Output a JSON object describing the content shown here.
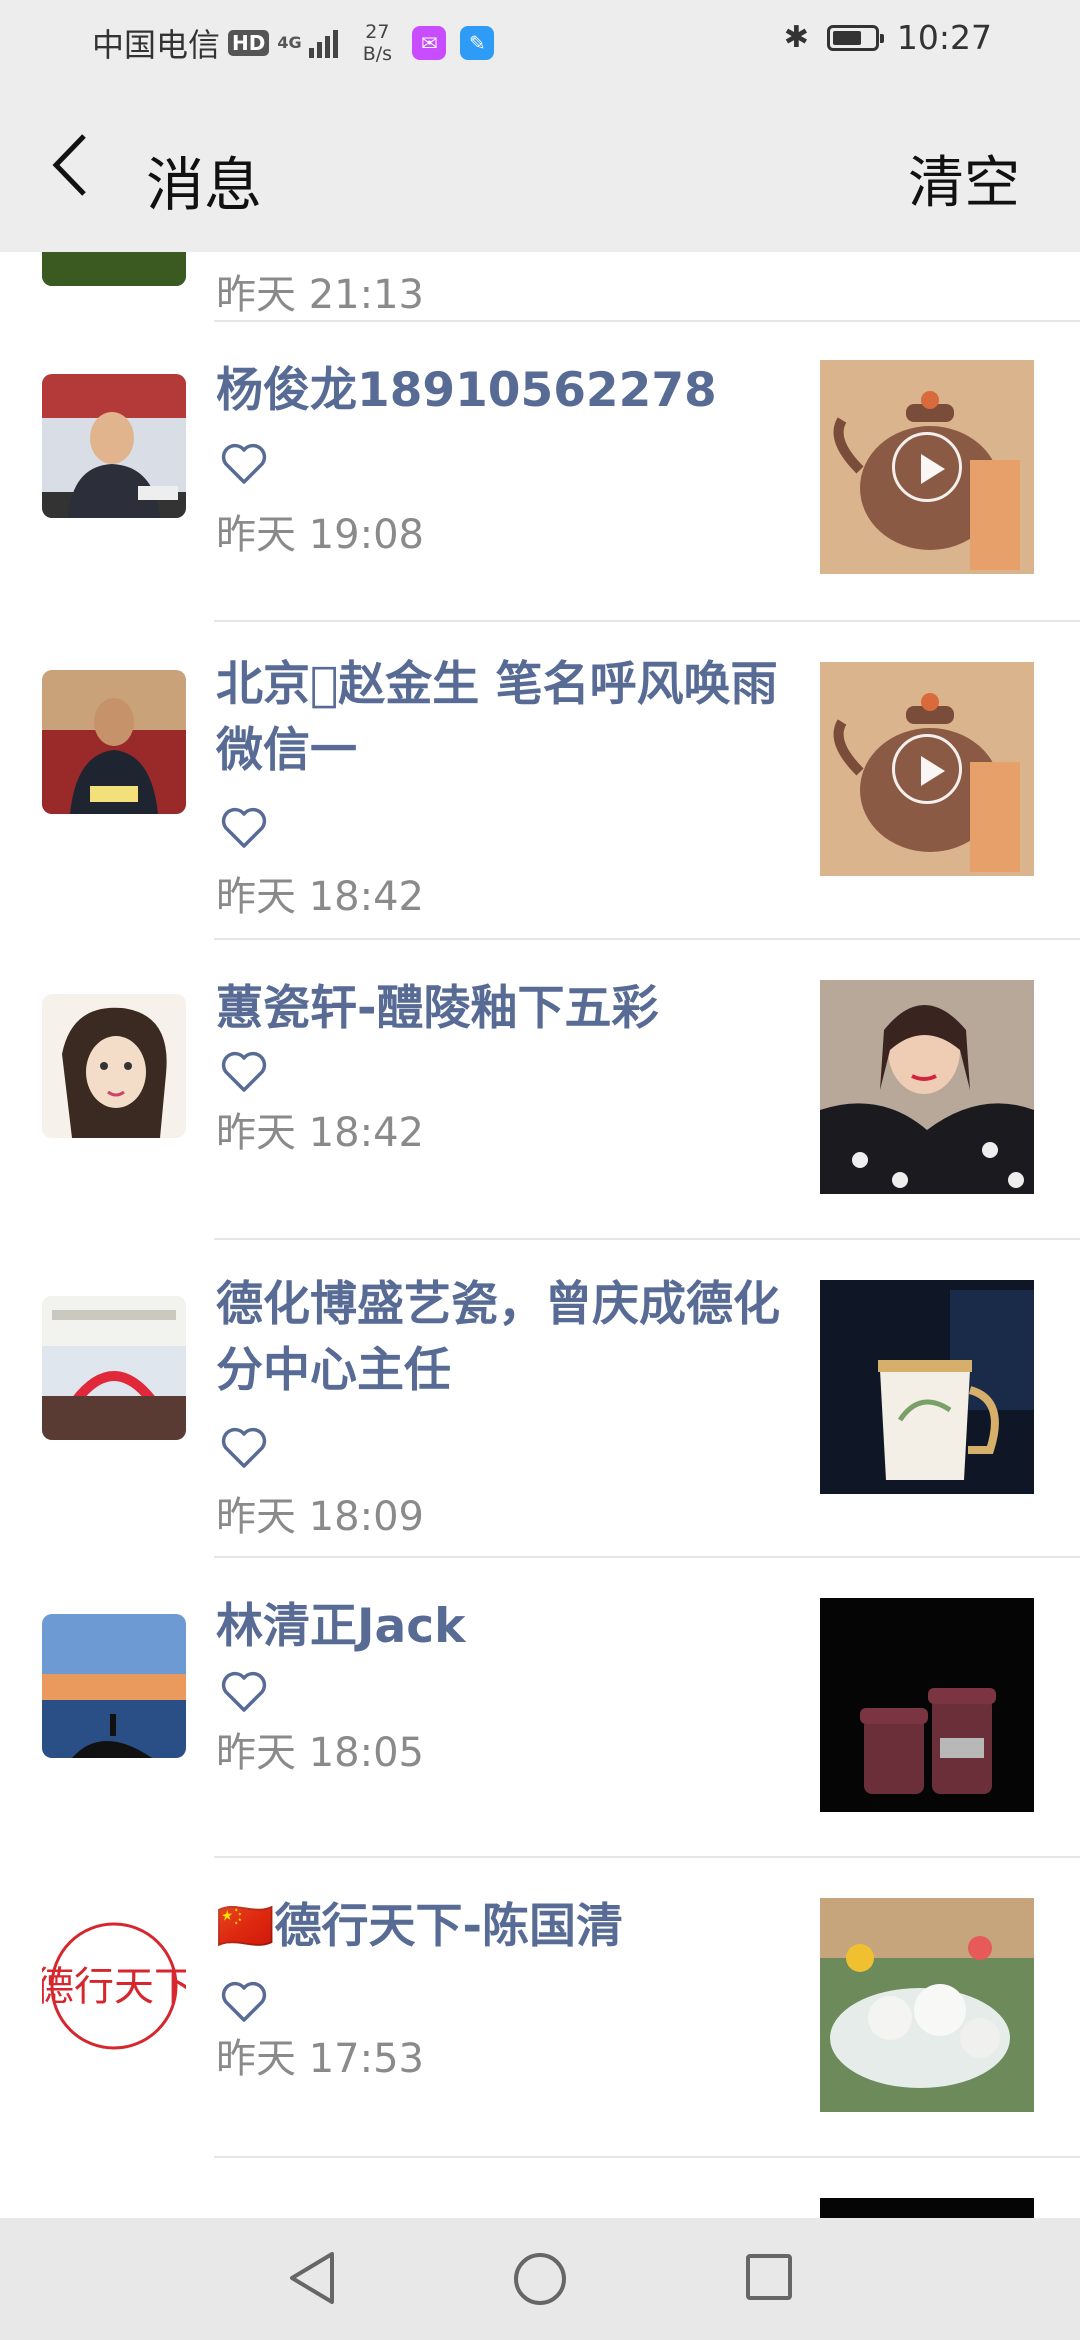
{
  "status_bar": {
    "carrier": "中国电信",
    "hd": "HD",
    "net_type": "4G",
    "speed": "27\nB/s",
    "time": "10:27"
  },
  "nav": {
    "title": "消息",
    "clear_label": "清空"
  },
  "messages": [
    {
      "name": "",
      "time": "昨天 21:13"
    },
    {
      "name": "杨俊龙18910562278",
      "time": "昨天 19:08"
    },
    {
      "name": "北京􏿾赵金生 笔名呼风唤雨微信一",
      "time": "昨天 18:42"
    },
    {
      "name": "蕙瓷轩-醴陵釉下五彩",
      "time": "昨天 18:42"
    },
    {
      "name": "德化博盛艺瓷，曾庆成德化分中心主任",
      "time": "昨天 18:09"
    },
    {
      "name": "林清正Jack",
      "time": "昨天 18:05"
    },
    {
      "name": "🇨🇳德行天下-陈国清",
      "time": "昨天 17:53"
    }
  ],
  "avatar_text": {
    "logo": "德行天下"
  },
  "colors": {
    "name": "#576b95",
    "time": "#8a8a8a",
    "bar_bg": "#ededed"
  },
  "icons": {
    "like": "heart-outline-icon",
    "back": "chevron-left-icon",
    "video": "play-circle-icon"
  }
}
